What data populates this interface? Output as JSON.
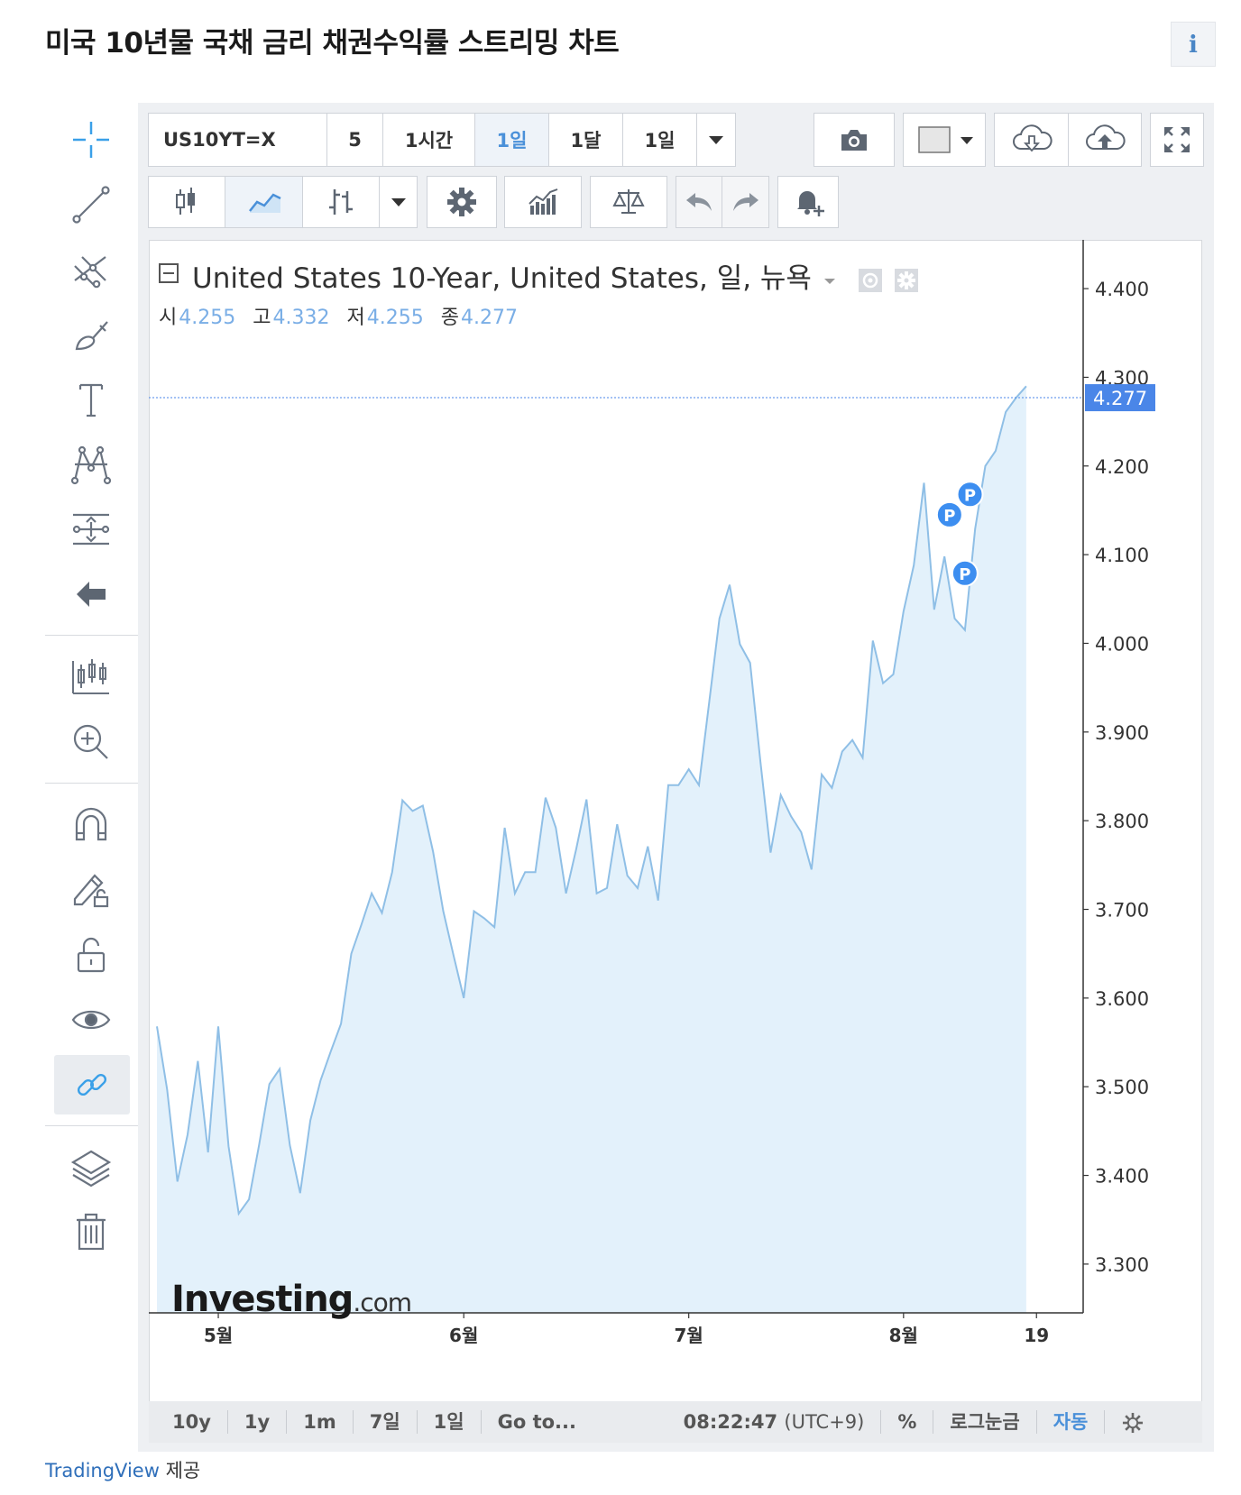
{
  "page": {
    "title": "미국 10년물 국채 금리 채권수익률 스트리밍 차트",
    "info_icon": "i"
  },
  "toolbar_top": {
    "symbol": "US10YT=X",
    "intervals": [
      "5",
      "1시간",
      "1일",
      "1달",
      "1일"
    ],
    "selected_interval": "1일"
  },
  "legend": {
    "title": "United States 10-Year, United States, 일, 뉴욕",
    "open_label": "시",
    "open": "4.255",
    "high_label": "고",
    "high": "4.332",
    "low_label": "저",
    "low": "4.255",
    "close_label": "종",
    "close": "4.277"
  },
  "watermark": {
    "brand": "Investing",
    "suffix": ".com"
  },
  "bottom_bar": {
    "ranges": [
      "10y",
      "1y",
      "1m",
      "7일",
      "1일"
    ],
    "goto": "Go to...",
    "time": "08:22:47",
    "timezone": "(UTC+9)",
    "percent": "%",
    "log": "로그눈금",
    "auto": "자동"
  },
  "credit": {
    "provider": "TradingView",
    "suffix": "제공"
  },
  "colors": {
    "line": "#8fbfe6",
    "fill": "#e3f1fb",
    "price_tag": "#4a86e8",
    "marker": "#3d8ef0"
  },
  "chart_data": {
    "type": "area",
    "ylim": [
      3.245,
      4.455
    ],
    "y_ticks": [
      3.3,
      3.4,
      3.5,
      3.6,
      3.7,
      3.8,
      3.9,
      4.0,
      4.1,
      4.2,
      4.3,
      4.4
    ],
    "x_ticks": [
      {
        "label": "5월",
        "x": 6
      },
      {
        "label": "6월",
        "x": 30
      },
      {
        "label": "7월",
        "x": 52
      },
      {
        "label": "8월",
        "x": 73
      },
      {
        "label": "19",
        "x": 86
      }
    ],
    "last_value": "4.277",
    "p_markers": [
      {
        "x": 77.5,
        "y": 4.145
      },
      {
        "x": 79.5,
        "y": 4.168
      },
      {
        "x": 79,
        "y": 4.079
      }
    ],
    "x": [
      0,
      1,
      2,
      3,
      4,
      5,
      6,
      7,
      8,
      9,
      10,
      11,
      12,
      13,
      14,
      15,
      16,
      17,
      18,
      19,
      20,
      21,
      22,
      23,
      24,
      25,
      26,
      27,
      28,
      29,
      30,
      31,
      32,
      33,
      34,
      35,
      36,
      37,
      38,
      39,
      40,
      41,
      42,
      43,
      44,
      45,
      46,
      47,
      48,
      49,
      50,
      51,
      52,
      53,
      54,
      55,
      56,
      57,
      58,
      59,
      60,
      61,
      62,
      63,
      64,
      65,
      66,
      67,
      68,
      69,
      70,
      71,
      72,
      73,
      74,
      75,
      76,
      77,
      78,
      79,
      80,
      81,
      82,
      83,
      84,
      85
    ],
    "y": [
      3.568,
      3.497,
      3.393,
      3.446,
      3.529,
      3.426,
      3.568,
      3.433,
      3.357,
      3.373,
      3.435,
      3.503,
      3.52,
      3.434,
      3.38,
      3.462,
      3.507,
      3.54,
      3.571,
      3.65,
      3.683,
      3.718,
      3.696,
      3.742,
      3.823,
      3.811,
      3.817,
      3.765,
      3.698,
      3.648,
      3.6,
      3.698,
      3.69,
      3.68,
      3.792,
      3.718,
      3.742,
      3.742,
      3.826,
      3.792,
      3.718,
      3.768,
      3.824,
      3.718,
      3.724,
      3.796,
      3.738,
      3.724,
      3.771,
      3.71,
      3.84,
      3.84,
      3.858,
      3.84,
      3.934,
      4.028,
      4.066,
      3.999,
      3.978,
      3.867,
      3.764,
      3.829,
      3.805,
      3.787,
      3.745,
      3.852,
      3.837,
      3.878,
      3.891,
      3.871,
      4.003,
      3.955,
      3.965,
      4.036,
      4.088,
      4.181,
      4.038,
      4.098,
      4.028,
      4.015,
      4.129,
      4.2,
      4.217,
      4.261,
      4.277,
      4.29
    ]
  }
}
